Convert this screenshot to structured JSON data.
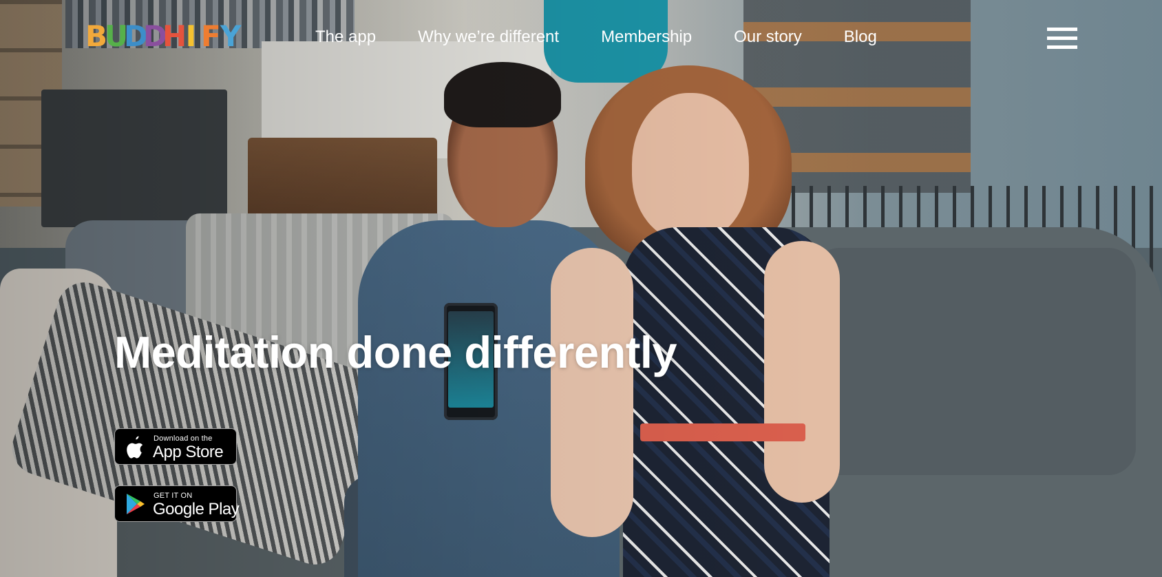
{
  "brand": {
    "logo_letters": [
      {
        "char": "B",
        "color": "#f2a93b"
      },
      {
        "char": "U",
        "color": "#56b04a"
      },
      {
        "char": "D",
        "color": "#3c8ec9"
      },
      {
        "char": "D",
        "color": "#8a4f9e"
      },
      {
        "char": "H",
        "color": "#e5533d"
      },
      {
        "char": "I",
        "color": "#f5c230"
      },
      {
        "char": "F",
        "color": "#ef7d31"
      },
      {
        "char": "Y",
        "color": "#4aa3d6"
      }
    ]
  },
  "nav": {
    "items": [
      {
        "label": "The app"
      },
      {
        "label": "Why we’re different"
      },
      {
        "label": "Membership"
      },
      {
        "label": "Our story"
      },
      {
        "label": "Blog"
      }
    ],
    "menu_icon": "hamburger-menu-icon"
  },
  "hero": {
    "headline": "Meditation done differently",
    "app_store": {
      "small": "Download on the",
      "big": "App Store",
      "icon": "apple-icon"
    },
    "google_play": {
      "small": "GET IT ON",
      "big": "Google Play",
      "icon": "google-play-icon"
    }
  }
}
